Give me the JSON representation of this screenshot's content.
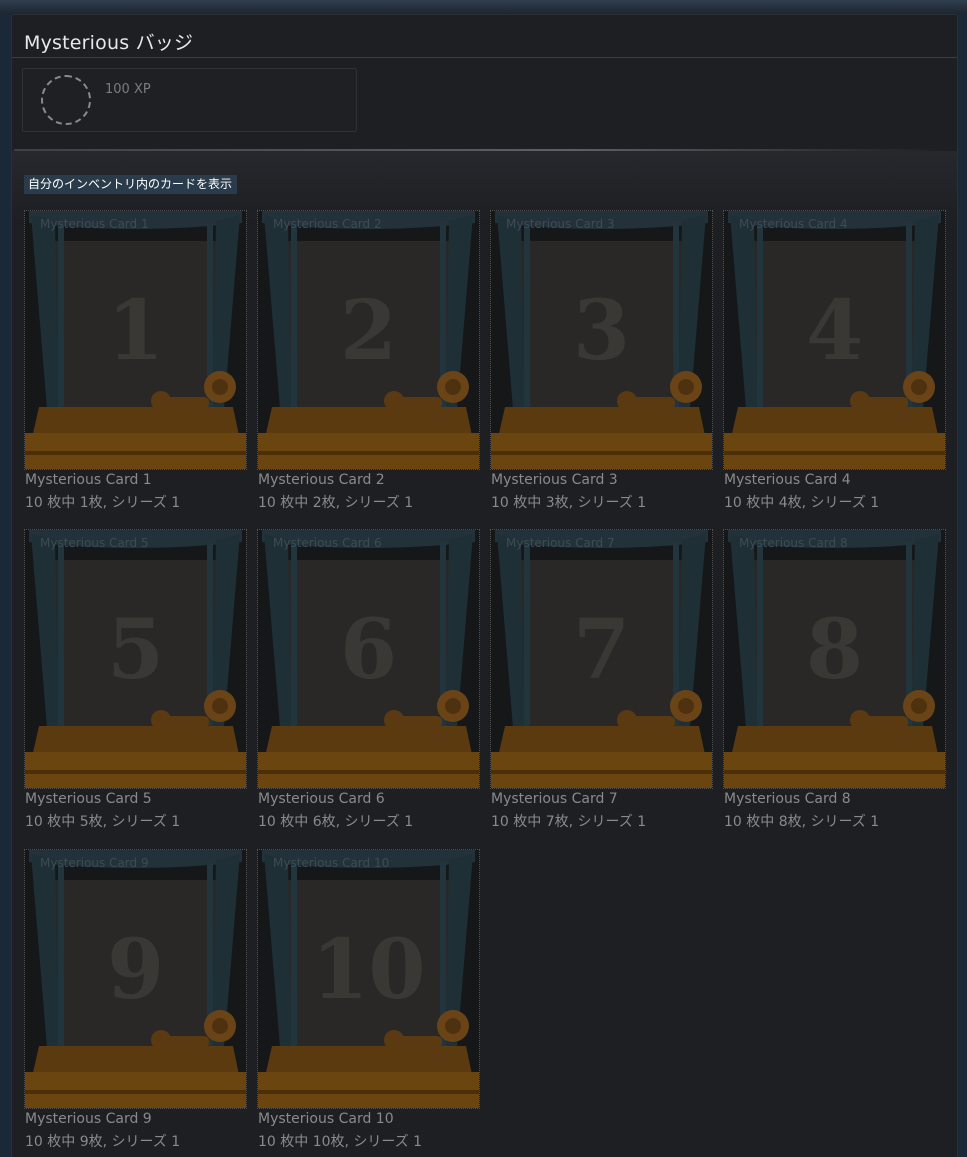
{
  "badge": {
    "title": "Mysterious バッジ",
    "xp": "100 XP"
  },
  "inventory_link": "自分のインベントリ内のカードを表示",
  "cards": [
    {
      "name": "Mysterious Card 1",
      "number": "1",
      "count": "10 枚中 1枚, シリーズ 1"
    },
    {
      "name": "Mysterious Card 2",
      "number": "2",
      "count": "10 枚中 2枚, シリーズ 1"
    },
    {
      "name": "Mysterious Card 3",
      "number": "3",
      "count": "10 枚中 3枚, シリーズ 1"
    },
    {
      "name": "Mysterious Card 4",
      "number": "4",
      "count": "10 枚中 4枚, シリーズ 1"
    },
    {
      "name": "Mysterious Card 5",
      "number": "5",
      "count": "10 枚中 5枚, シリーズ 1"
    },
    {
      "name": "Mysterious Card 6",
      "number": "6",
      "count": "10 枚中 6枚, シリーズ 1"
    },
    {
      "name": "Mysterious Card 7",
      "number": "7",
      "count": "10 枚中 7枚, シリーズ 1"
    },
    {
      "name": "Mysterious Card 8",
      "number": "8",
      "count": "10 枚中 8枚, シリーズ 1"
    },
    {
      "name": "Mysterious Card 9",
      "number": "9",
      "count": "10 枚中 9枚, シリーズ 1"
    },
    {
      "name": "Mysterious Card 10",
      "number": "10",
      "count": "10 枚中 10枚, シリーズ 1"
    }
  ],
  "colors": {
    "background": "#1d1f23",
    "link_bg": "#2a3c4b",
    "text_muted": "#8a8a8a",
    "card_wood": "#7a4e12"
  }
}
